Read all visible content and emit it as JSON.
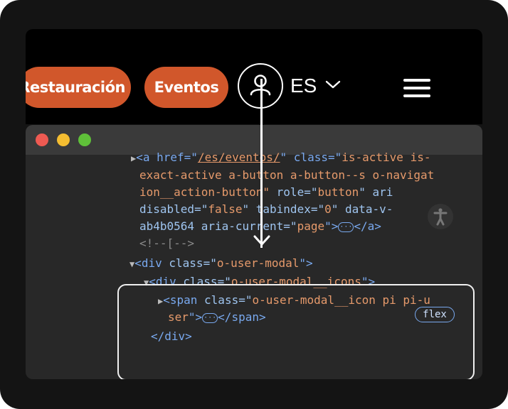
{
  "site_nav": {
    "button_restauracion": "Restauración",
    "button_eventos": "Eventos",
    "language": "ES"
  },
  "colors": {
    "accent": "#d1572b",
    "devtools_bg": "#282828",
    "tag": "#79a9ef",
    "value": "#e69a6b"
  },
  "code": {
    "l1_prefix": "<a href=\"",
    "l1_href": "/es/eventos/",
    "l1_mid": "\" class=\"",
    "l1_class": "is-active is-",
    "l2": "exact-active a-button a-button--s o-navigat",
    "l3_class_end": "ion__action-button\"",
    "l3_role_attr": " role=\"",
    "l3_role_val": "button",
    "l3_rest": "\" ari",
    "l4_attr": "disabled=\"",
    "l4_val": "false",
    "l4_mid": "\" tabindex=\"",
    "l4_tab": "0",
    "l4_end": "\" data-v-",
    "l5_attr": "ab4b0564 aria-current=\"",
    "l5_val": "page",
    "l5_end": "\">",
    "l5_close": "</a>",
    "l6_comment": "<!--[-->",
    "l7_open": "<div",
    "l7_attr": " class=\"",
    "l7_val": "o-user-modal",
    "l7_end": "\">",
    "l8_open": "<div",
    "l8_attr": " class=\"",
    "l8_val": "o-user-modal__icons",
    "l8_end": "\">",
    "l8_badge": "flex",
    "l9_open": "<span",
    "l9_attr": " class=\"",
    "l9_val": "o-user-modal__icon pi pi-u",
    "l10_val": "ser",
    "l10_end": "\">",
    "l10_close": "</span>",
    "l11_close": "</div>",
    "ellipsis": "···"
  }
}
